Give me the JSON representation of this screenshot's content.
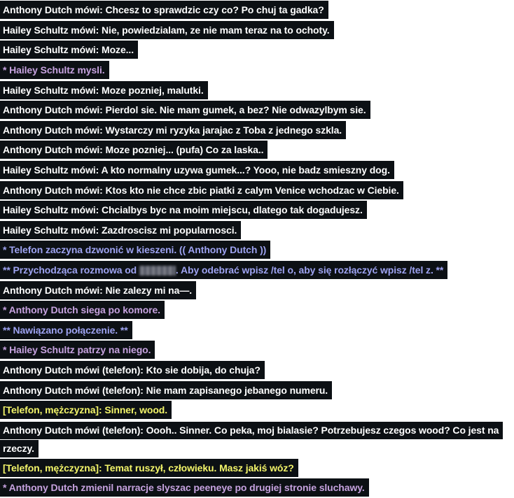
{
  "colors": {
    "say": "#ffffff",
    "me": "#c6a2df",
    "system": "#9ea3f1",
    "phone": "#f3f56a",
    "background": "#0c1014"
  },
  "chat": {
    "lines": [
      {
        "type": "say",
        "text": "Anthony Dutch mówi: Chcesz to sprawdzic czy co? Po chuj ta gadka?"
      },
      {
        "type": "say",
        "text": "Hailey Schultz mówi: Nie, powiedzialam, ze nie mam teraz na to ochoty."
      },
      {
        "type": "say",
        "text": "Hailey Schultz mówi: Moze..."
      },
      {
        "type": "me",
        "text": "* Hailey Schultz mysli."
      },
      {
        "type": "say",
        "text": "Hailey Schultz mówi: Moze pozniej, malutki."
      },
      {
        "type": "say",
        "text": "Anthony Dutch mówi: Pierdol sie. Nie mam gumek, a bez? Nie odwazylbym sie."
      },
      {
        "type": "say",
        "text": "Anthony Dutch mówi: Wystarczy mi ryzyka jarajac z Toba z jednego szkla."
      },
      {
        "type": "say",
        "text": "Anthony Dutch mówi: Moze pozniej... (pufa) Co za laska.."
      },
      {
        "type": "say",
        "text": "Hailey Schultz mówi: A kto normalny uzywa gumek...? Yooo, nie badz smieszny dog."
      },
      {
        "type": "say",
        "text": "Anthony Dutch mówi: Ktos kto nie chce zbic piatki z calym Venice wchodzac w Ciebie."
      },
      {
        "type": "say",
        "text": "Hailey Schultz mówi: Chcialbys byc na moim miejscu, dlatego tak dogadujesz."
      },
      {
        "type": "say",
        "text": "Hailey Schultz mówi: Zazdroscisz mi popularnosci."
      },
      {
        "type": "system",
        "text": "* Telefon zaczyna dzwonić w kieszeni. (( Anthony Dutch ))"
      },
      {
        "type": "system",
        "text_before": "** Przychodząca rozmowa od ",
        "text_after": ". Aby odebrać wpisz /tel o, aby się rozłączyć wpisz /tel z. **"
      },
      {
        "type": "say",
        "text": "Anthony Dutch mówi: Nie zalezy mi na—."
      },
      {
        "type": "me",
        "text": "* Anthony Dutch siega po komore."
      },
      {
        "type": "system",
        "text": "** Nawiązano połączenie. **"
      },
      {
        "type": "me",
        "text": "* Hailey Schultz patrzy na niego."
      },
      {
        "type": "say",
        "text": "Anthony Dutch mówi (telefon): Kto sie dobija, do chuja?"
      },
      {
        "type": "say",
        "text": "Anthony Dutch mówi (telefon): Nie mam zapisanego jebanego numeru."
      },
      {
        "type": "phone",
        "text": "[Telefon, mężczyzna]: Sinner, wood."
      },
      {
        "type": "say",
        "text": "Anthony Dutch mówi (telefon): Oooh.. Sinner. Co peka, moj bialasie? Potrzebujesz czegos wood? Co jest na rzeczy."
      },
      {
        "type": "phone",
        "text": "[Telefon, mężczyzna]: Temat ruszył, człowieku. Masz jakiś wóz?"
      },
      {
        "type": "me",
        "text": "* Anthony Dutch zmienil narracje slyszac peeneye po drugiej stronie sluchawy."
      }
    ]
  }
}
